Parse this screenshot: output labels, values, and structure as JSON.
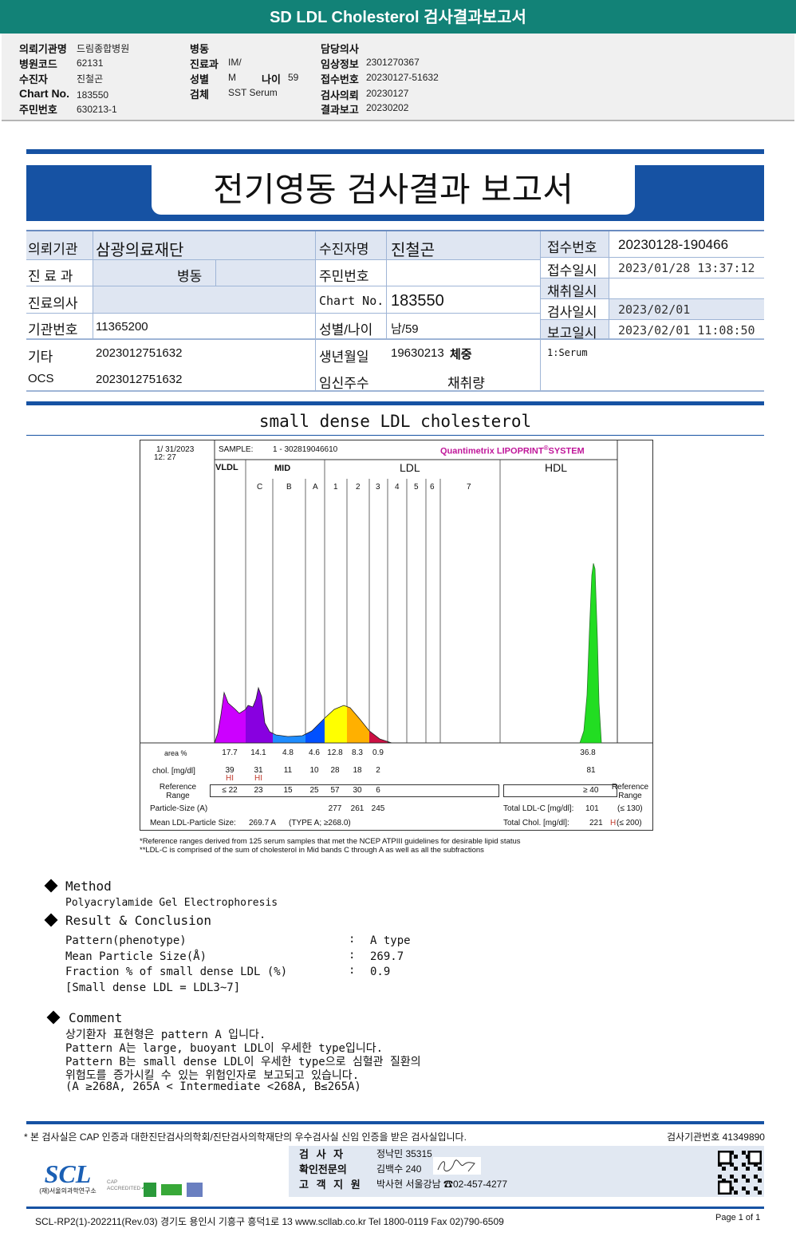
{
  "header": {
    "title": "SD LDL Cholesterol 검사결과보고서"
  },
  "info": {
    "col1": [
      {
        "label": "의뢰기관명",
        "value": "드림종합병원"
      },
      {
        "label": "병원코드",
        "value": "62131"
      },
      {
        "label": "수진자",
        "value": "진철곤"
      },
      {
        "label": "Chart No.",
        "value": "183550"
      },
      {
        "label": "주민번호",
        "value": "630213-1"
      }
    ],
    "col2": [
      {
        "label": "병동",
        "value": ""
      },
      {
        "label": "진료과",
        "value": "IM/"
      },
      {
        "label": "성별",
        "value": "M"
      },
      {
        "label": "검체",
        "value": "SST Serum"
      }
    ],
    "age_label": "나이",
    "age_value": "59",
    "col3": [
      {
        "label": "담당의사",
        "value": ""
      },
      {
        "label": "임상정보",
        "value": "2301270367"
      },
      {
        "label": "접수번호",
        "value": "20230127-51632"
      },
      {
        "label": "검사의뢰",
        "value": "20230127"
      },
      {
        "label": "결과보고",
        "value": "20230202"
      }
    ]
  },
  "report": {
    "title": "전기영동 검사결과 보고서",
    "rows": {
      "institution_label": "의뢰기관",
      "institution": "삼광의료재단",
      "patient_label": "수진자명",
      "patient": "진철곤",
      "dept_label": "진 료 과",
      "ward_label": "병동",
      "ssn_label": "주민번호",
      "ssn": "",
      "doctor_label": "진료의사",
      "doctor": "",
      "chart_label": "Chart No.",
      "chart": "183550",
      "inst_no_label": "기관번호",
      "inst_no": "11365200",
      "sexage_label": "성별/나이",
      "sexage": "남/59",
      "etc_label": "기타",
      "etc": "2023012751632",
      "dob_label": "생년월일",
      "dob": "19630213",
      "weight_label": "체중",
      "ocs_label": "OCS",
      "ocs": "2023012751632",
      "preg_label": "임신주수",
      "collect_amt_label": "채취량",
      "receipt_no_label": "접수번호",
      "receipt_no": "20230128-190466",
      "receipt_dt_label": "접수일시",
      "receipt_dt": "2023/01/28 13:37:12",
      "collect_dt_label": "채취일시",
      "collect_dt": "",
      "test_dt_label": "검사일시",
      "test_dt": "2023/02/01",
      "report_dt_label": "보고일시",
      "report_dt": "2023/02/01 11:08:50",
      "specimen": "1:Serum"
    },
    "section_title": "small dense LDL cholesterol"
  },
  "chart_data": {
    "type": "area",
    "date": "1/ 31/2023",
    "time": "12: 27",
    "sample_label": "SAMPLE:",
    "sample": "1 - 302819046610",
    "brand": "Quantimetrix LIPOPRINT",
    "brand_suffix": "SYSTEM",
    "groups": [
      "VLDL",
      "MID",
      "LDL",
      "HDL"
    ],
    "bands": [
      "C",
      "B",
      "A",
      "1",
      "2",
      "3",
      "4",
      "5",
      "6",
      "7"
    ],
    "band_colors": {
      "VLDL": "#cc00ff",
      "C": "#8800e0",
      "B": "#1e8cff",
      "A": "#0050ff",
      "1": "#ffff00",
      "2": "#ffb000",
      "3": "#cc1144",
      "HDL": "#22dd22"
    },
    "row_labels": {
      "area": "area %",
      "chol": "chol. [mg/dl]",
      "ref": "Reference Range",
      "ref_right": "Reference Range",
      "particle": "Particle-Size (A)",
      "mean": "Mean LDL-Particle Size:"
    },
    "area_pct": [
      "17.7",
      "14.1",
      "4.8",
      "4.6",
      "12.8",
      "8.3",
      "0.9"
    ],
    "hdl_area_pct": "36.8",
    "chol": [
      "39",
      "31",
      "11",
      "10",
      "28",
      "18",
      "2"
    ],
    "hdl_chol": "81",
    "flags": [
      "HI",
      "HI",
      "",
      "",
      "",
      "",
      ""
    ],
    "reference": [
      "≤ 22",
      "23",
      "15",
      "25",
      "57",
      "30",
      "6"
    ],
    "hdl_reference": "≥ 40",
    "particle_size": [
      "277",
      "261",
      "245"
    ],
    "mean_size": "269.7 A",
    "mean_type": "(TYPE A; ≥268.0)",
    "total_ldl_label": "Total LDL-C [mg/dl]:",
    "total_ldl": "101",
    "total_ldl_ref": "(≤ 130)",
    "total_chol_label": "Total Chol. [mg/dl]:",
    "total_chol": "221",
    "total_chol_flag": "H",
    "total_chol_ref": "(≤ 200)",
    "footnote1": "*Reference ranges derived from 125 serum samples that met the NCEP ATPIII guidelines for desirable lipid status",
    "footnote2": "**LDL-C is comprised of the sum of cholesterol in Mid bands C through A as well as all the subfractions"
  },
  "method": {
    "title": "Method",
    "text": "Polyacrylamide Gel Electrophoresis"
  },
  "result": {
    "title": "Result & Conclusion",
    "items": [
      {
        "label": "Pattern(phenotype)",
        "value": "A type"
      },
      {
        "label": "Mean Particle Size(Å)",
        "value": "269.7"
      },
      {
        "label": "Fraction % of small dense LDL (%)",
        "value": "0.9"
      }
    ],
    "note": "[Small dense LDL = LDL3~7]"
  },
  "comment": {
    "title": "Comment",
    "lines": [
      "상기환자 표현형은 pattern A 입니다.",
      "Pattern A는 large, buoyant LDL이 우세한 type입니다.",
      "Pattern B는 small dense LDL이 우세한 type으로 심혈관 질환의",
      "위험도를 증가시킬 수 있는 위험인자로 보고되고 있습니다.",
      "(A ≥268A, 265A < Intermediate <268A, B≤265A)"
    ]
  },
  "footer": {
    "cert": "* 본 검사실은 CAP 인증과 대한진단검사의학회/진단검사의학재단의 우수검사실 신임 인증을 받은 검사실입니다.",
    "inst_no": "검사기관번호 41349890",
    "examiner_label": "검 사 자",
    "examiner": "정낙민 35315",
    "confirm_label": "확인전문의",
    "confirm": "김백수 240",
    "support_label": "고 객 지 원",
    "support": "박사현 서울강남 ☎02-457-4277",
    "logo": "SCL",
    "logo_sub": "(재)서울의과학연구소",
    "cap": "CAP ACCREDITED",
    "address": "SCL-RP2(1)-202211(Rev.03)  경기도 용인시 기흥구 흥덕1로 13  www.scllab.co.kr  Tel 1800-0119   Fax 02)790-6509",
    "page": "Page 1 of 1"
  }
}
